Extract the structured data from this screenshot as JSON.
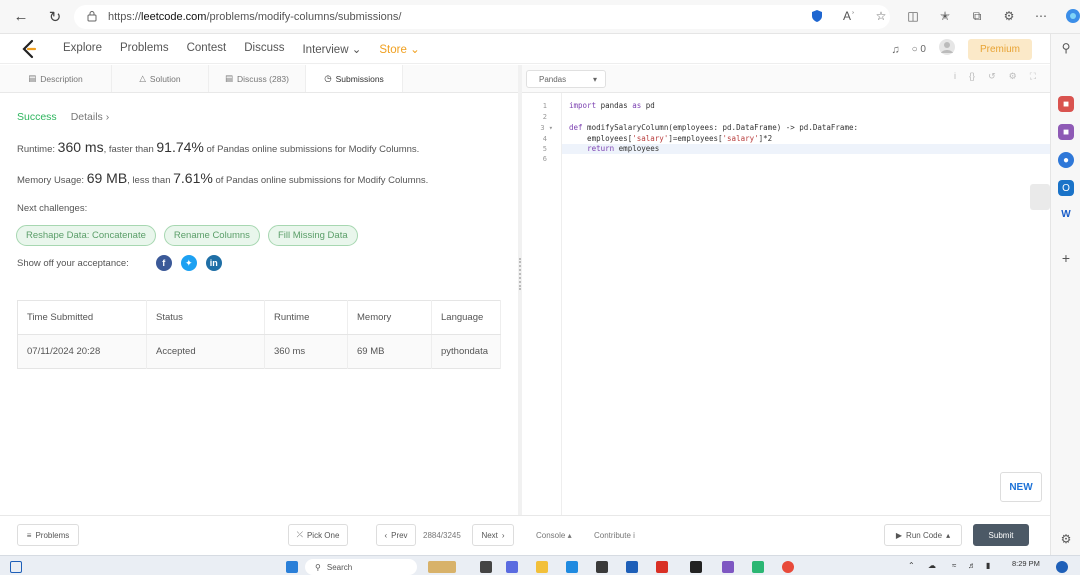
{
  "browser": {
    "url_prefix": "https://",
    "url_host": "leetcode.com",
    "url_path": "/problems/modify-columns/submissions/"
  },
  "header": {
    "nav": [
      {
        "label": "Explore"
      },
      {
        "label": "Problems"
      },
      {
        "label": "Contest"
      },
      {
        "label": "Discuss"
      },
      {
        "label": "Interview"
      },
      {
        "label": "Store"
      }
    ],
    "notification_count": "0",
    "premium_label": "Premium"
  },
  "tabs": [
    {
      "label": "Description",
      "icon": "document-icon"
    },
    {
      "label": "Solution",
      "icon": "flask-icon"
    },
    {
      "label": "Discuss (283)",
      "icon": "comment-icon"
    },
    {
      "label": "Submissions",
      "icon": "clock-icon",
      "active": true
    }
  ],
  "result": {
    "status": "Success",
    "details_link": "Details ›",
    "runtime_label": "Runtime:",
    "runtime_value": "360 ms",
    "runtime_mid": ", faster than",
    "runtime_percent": "91.74%",
    "runtime_tail": "of Pandas online submissions for Modify Columns.",
    "memory_label": "Memory Usage:",
    "memory_value": "69 MB",
    "memory_mid": ", less than",
    "memory_percent": "7.61%",
    "memory_tail": "of Pandas online submissions for Modify Columns.",
    "next_label": "Next challenges:",
    "challenges": [
      "Reshape Data: Concatenate",
      "Rename Columns",
      "Fill Missing Data"
    ],
    "share_label": "Show off your acceptance:"
  },
  "table": {
    "headers": [
      "Time Submitted",
      "Status",
      "Runtime",
      "Memory",
      "Language"
    ],
    "rows": [
      {
        "time": "07/11/2024 20:28",
        "status": "Accepted",
        "runtime": "360 ms",
        "memory": "69 MB",
        "language": "pythondata"
      }
    ]
  },
  "editor": {
    "language": "Pandas",
    "line_numbers": [
      "1",
      "2",
      "3 ▾",
      "4",
      "5",
      "6"
    ]
  },
  "footer": {
    "problems_label": "Problems",
    "pick_one_label": "Pick One",
    "prev_label": "Prev",
    "page_indicator": "2884/3245",
    "next_label": "Next",
    "console_label": "Console",
    "contribute_label": "Contribute",
    "run_code_label": "Run Code",
    "submit_label": "Submit",
    "new_label": "NEW"
  },
  "taskbar": {
    "search_label": "Search",
    "time": "8:29 PM"
  }
}
